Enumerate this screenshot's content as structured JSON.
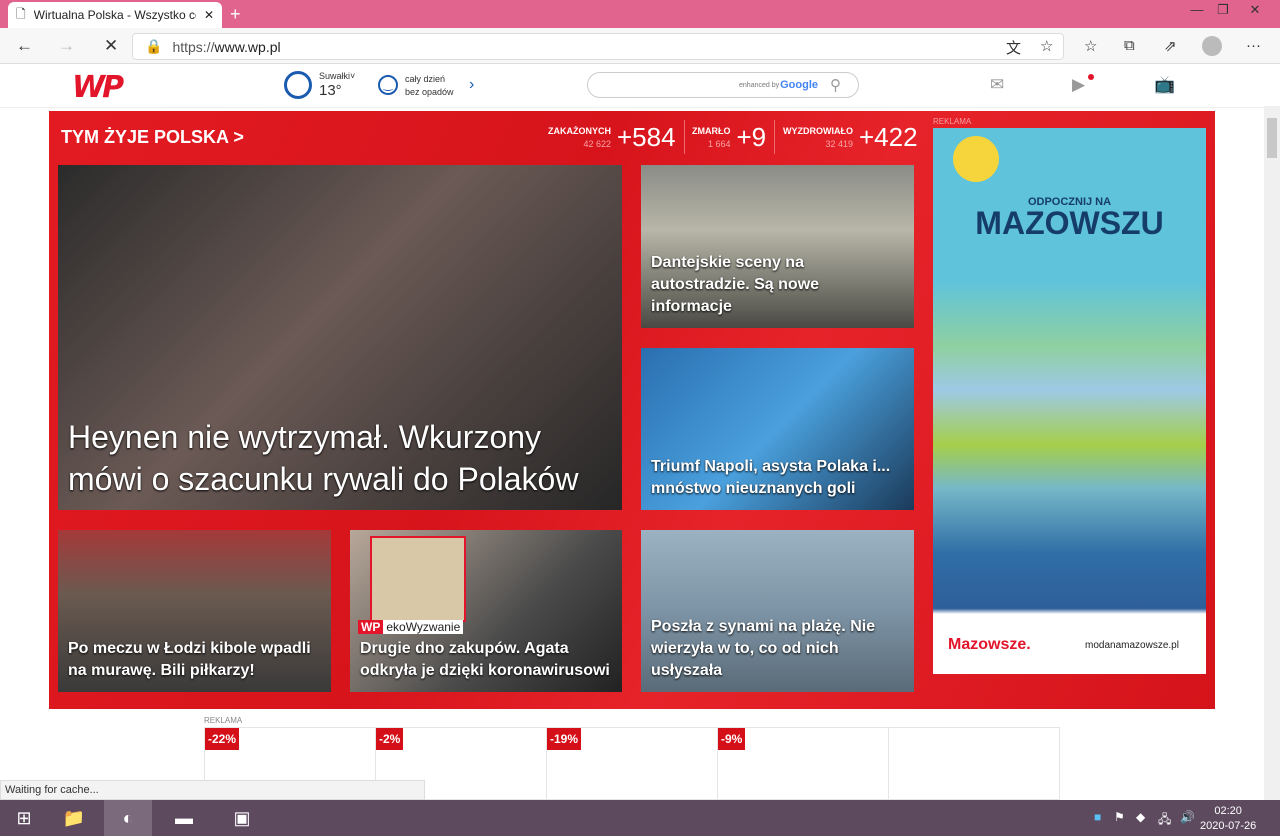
{
  "browser": {
    "tab_title": "Wirtualna Polska - Wszystko co w",
    "url_prefix": "https://",
    "url_host": "www.wp.pl",
    "status": "Waiting for cache..."
  },
  "header": {
    "logo": "WP",
    "weather_city": "Suwałki",
    "temperature": "13°",
    "forecast_line1": "cały dzień",
    "forecast_line2": "bez opadów",
    "search_brand_prefix": "enhanced by",
    "search_brand": "Google"
  },
  "section": {
    "title": "TYM ŻYJE POLSKA >",
    "stats": [
      {
        "label": "ZAKAŻONYCH",
        "total": "42 622",
        "delta": "+584"
      },
      {
        "label": "ZMARŁO",
        "total": "1 664",
        "delta": "+9"
      },
      {
        "label": "WYZDROWIAŁO",
        "total": "32 419",
        "delta": "+422"
      }
    ]
  },
  "tiles": [
    {
      "caption": "Heynen nie wytrzymał. Wkurzony mówi o szacunku rywali do Polaków"
    },
    {
      "caption": "Dantejskie sceny na autostradzie. Są nowe informacje"
    },
    {
      "caption": "Triumf Napoli, asysta Polaka i... mnóstwo nieuznanych goli"
    },
    {
      "caption": "Po meczu w Łodzi kibole wpadli na murawę. Bili piłkarzy!"
    },
    {
      "caption": "Drugie dno zakupów. Agata odkryła je dzięki koronawirusowi",
      "badge_wp": "WP",
      "badge": "ekoWyzwanie"
    },
    {
      "caption": "Poszła z synami na plażę. Nie wierzyła w to, co od nich usłyszała"
    }
  ],
  "ad": {
    "label": "REKLAMA",
    "line1": "ODPOCZNIJ NA",
    "line2": "MAZOWSZU",
    "brand": "Mazowsze.",
    "url": "modanamazowsze.pl"
  },
  "shop": {
    "label": "REKLAMA",
    "discounts": [
      "-22%",
      "-2%",
      "-19%",
      "-9%"
    ]
  },
  "taskbar": {
    "time": "02:20",
    "date": "2020-07-26"
  },
  "colors": {
    "brand_red": "#e2152b",
    "tab_bar": "#e0648e",
    "taskbar": "#5d4a5f"
  }
}
